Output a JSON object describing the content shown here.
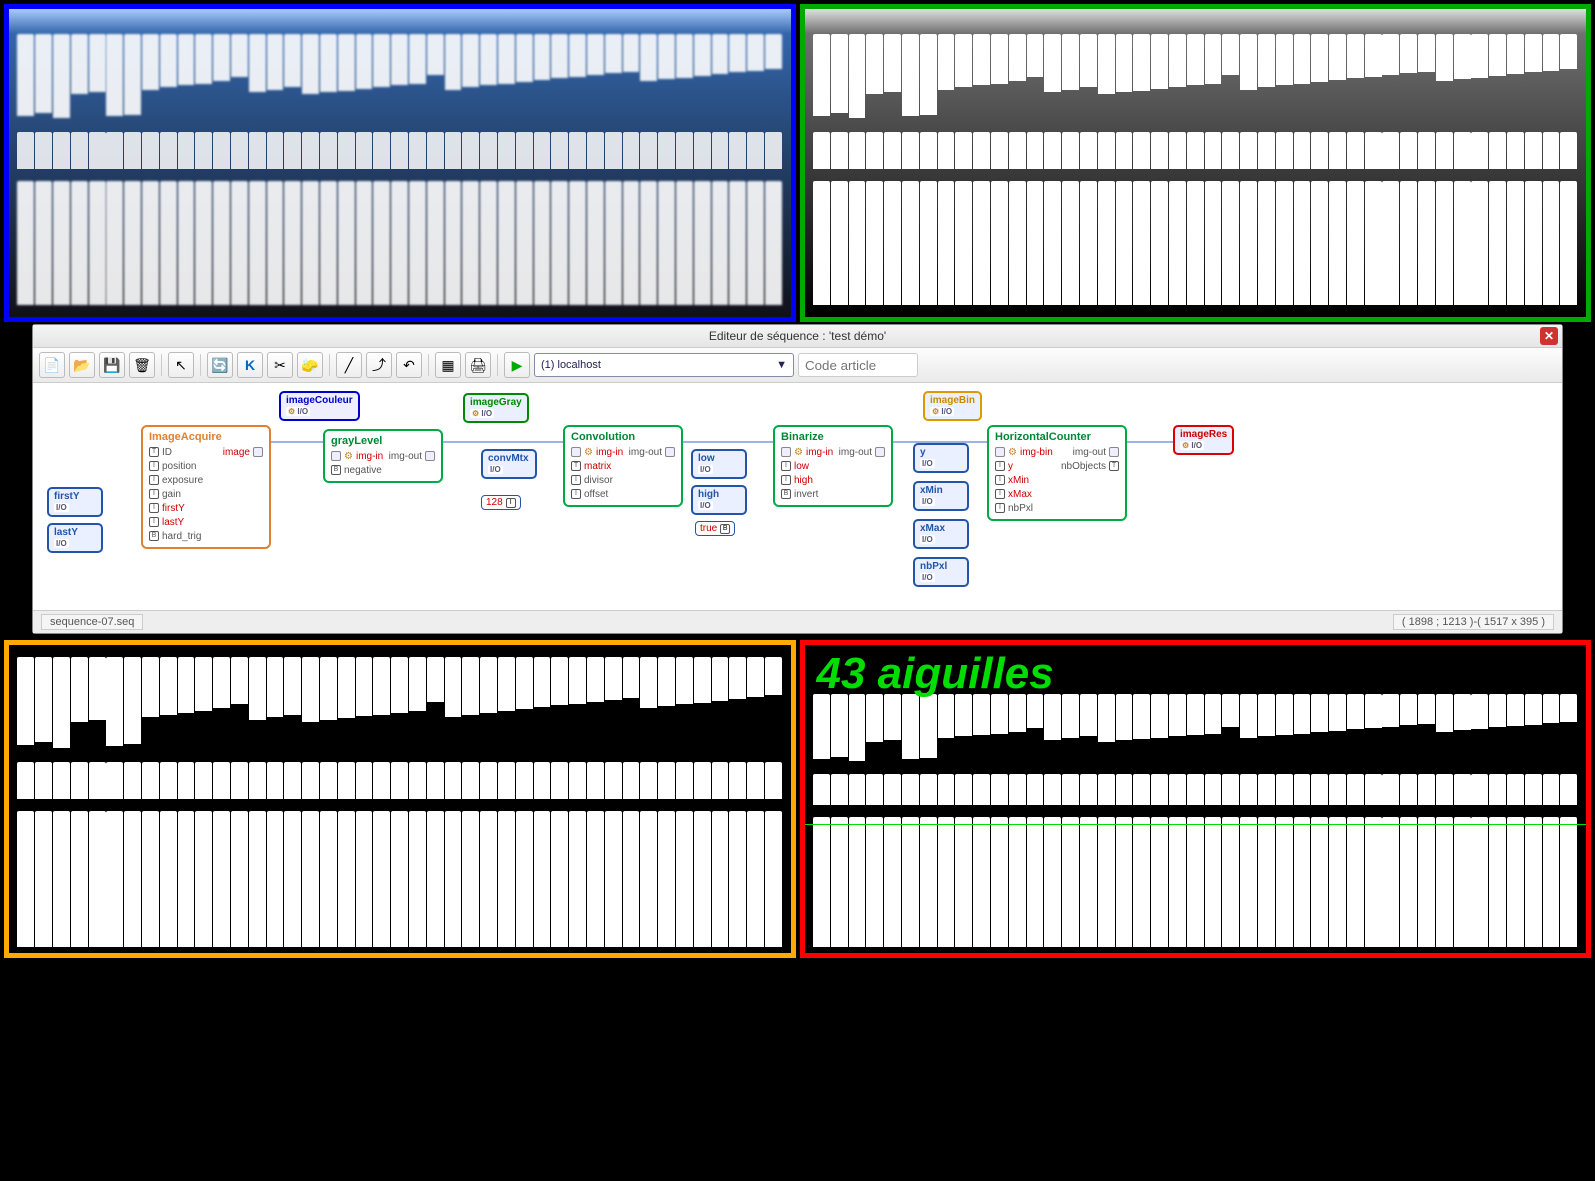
{
  "editor": {
    "title": "Editeur de séquence : 'test démo'",
    "host_option": "(1) localhost",
    "code_placeholder": "Code article",
    "status_left": "sequence-07.seq",
    "status_right": "( 1898 ; 1213 )-( 1517 x 395 )"
  },
  "result": {
    "text": "43 aiguilles"
  },
  "nodes": {
    "firstY": {
      "name": "firstY"
    },
    "lastY": {
      "name": "lastY"
    },
    "imageAcquire": {
      "name": "ImageAcquire",
      "params": [
        "ID",
        "position",
        "exposure",
        "gain",
        "firstY",
        "lastY",
        "hard_trig"
      ],
      "out": "image"
    },
    "imageCouleur": {
      "name": "imageCouleur"
    },
    "grayLevel": {
      "name": "grayLevel",
      "in": "img-in",
      "param": "negative",
      "out": "img-out"
    },
    "imageGray": {
      "name": "imageGray"
    },
    "convMtx": {
      "name": "convMtx"
    },
    "val128": "128",
    "convolution": {
      "name": "Convolution",
      "in": "img-in",
      "params": [
        "matrix",
        "divisor",
        "offset"
      ],
      "out": "img-out"
    },
    "low": {
      "name": "low"
    },
    "high": {
      "name": "high"
    },
    "valTrue": "true",
    "binarize": {
      "name": "Binarize",
      "in": "img-in",
      "params": [
        "low",
        "high",
        "invert"
      ],
      "out": "img-out"
    },
    "imageBin": {
      "name": "imageBin"
    },
    "y": {
      "name": "y"
    },
    "xMin": {
      "name": "xMin"
    },
    "xMax": {
      "name": "xMax"
    },
    "nbPxl": {
      "name": "nbPxl"
    },
    "hCounter": {
      "name": "HorizontalCounter",
      "in": "img-bin",
      "params": [
        "y",
        "xMin",
        "xMax",
        "nbPxl"
      ],
      "out": [
        "img-out",
        "nbObjects"
      ]
    },
    "imageRes": {
      "name": "imageRes"
    }
  }
}
